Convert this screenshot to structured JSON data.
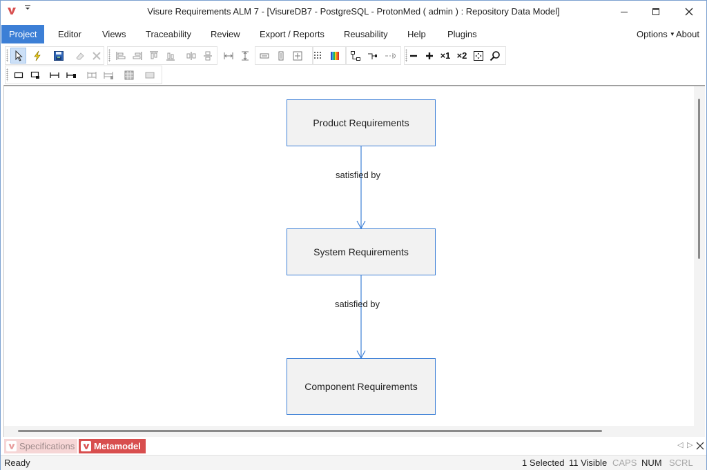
{
  "window": {
    "title": "Visure Requirements ALM 7 - [VisureDB7 - PostgreSQL - ProtonMed ( admin ) : Repository Data Model]",
    "logo_icon": "visure-v-logo-icon",
    "quick_access_icon": "quick-access-dropdown-icon",
    "controls": [
      "minimize-icon",
      "maximize-icon",
      "close-icon"
    ]
  },
  "menu": {
    "items": [
      {
        "label": "Project",
        "active": true
      },
      {
        "label": "Editor"
      },
      {
        "label": "Views"
      },
      {
        "label": "Traceability"
      },
      {
        "label": "Review"
      },
      {
        "label": "Export / Reports"
      },
      {
        "label": "Reusability"
      },
      {
        "label": "Help"
      },
      {
        "label": "Plugins"
      }
    ],
    "options_label": "Options",
    "about_label": "About"
  },
  "toolbar": {
    "zoom_x1_label": "×1",
    "zoom_x2_label": "×2",
    "row1_icons": [
      "select-pointer-icon",
      "lightning-icon",
      "save-model-icon",
      "eraser-icon",
      "delete-cross-icon",
      "align-left-icon",
      "align-center-icon",
      "align-top-icon",
      "align-bottom-icon",
      "distribute-horizontal-icon",
      "distribute-vertical-icon",
      "same-width-icon",
      "same-height-icon",
      "center-horizontal-icon",
      "center-vertical-icon",
      "center-both-icon",
      "grid-icon",
      "color-palette-icon",
      "layout-tree-icon",
      "connect-icon",
      "route-icon",
      "zoom-out-icon",
      "zoom-in-icon",
      "zoom-fit-icon",
      "zoom-search-icon"
    ],
    "row2_icons": [
      "rectangle-icon",
      "rectangle-shadow-icon",
      "connector-icon",
      "connector-end-icon",
      "link-split-icon",
      "link-merge-icon",
      "table-icon",
      "box-icon"
    ]
  },
  "diagram": {
    "nodes": [
      {
        "label": "Product Requirements"
      },
      {
        "label": "System Requirements"
      },
      {
        "label": "Component Requirements"
      }
    ],
    "edges": [
      {
        "from": "Product Requirements",
        "to": "System Requirements",
        "label": "satisfied by"
      },
      {
        "from": "System Requirements",
        "to": "Component Requirements",
        "label": "satisfied by"
      }
    ],
    "node_border_color": "#3c7fd6",
    "node_fill_color": "#f2f2f2",
    "edge_color": "#3c7fd6"
  },
  "tabs": {
    "items": [
      {
        "label": "Specifications",
        "active": false
      },
      {
        "label": "Metamodel",
        "active": true
      }
    ],
    "active_color": "#d84e4e",
    "inactive_color": "#f6d6d6"
  },
  "status": {
    "left": "Ready",
    "selected": "1 Selected",
    "visible": "11 Visible",
    "caps": "CAPS",
    "num": "NUM",
    "scrl": "SCRL"
  }
}
